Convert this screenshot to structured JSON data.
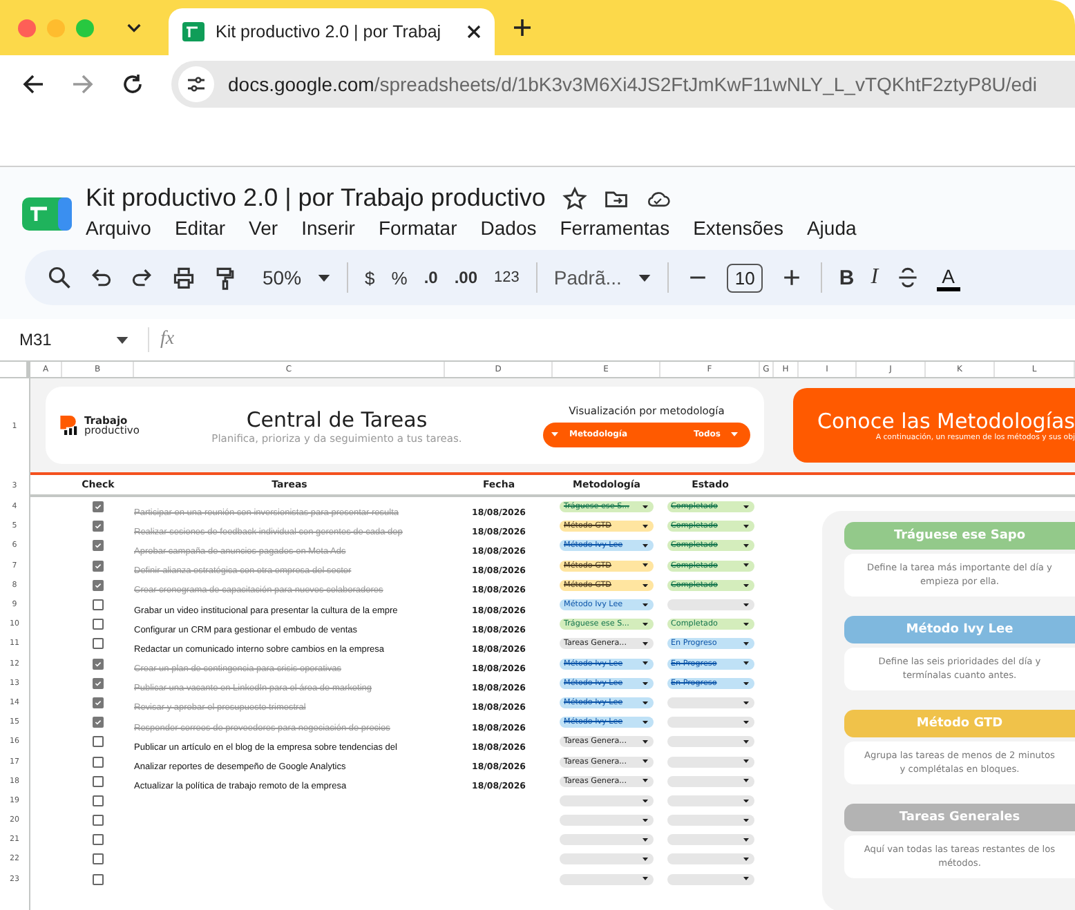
{
  "browser": {
    "tab_title": "Kit productivo 2.0 | por Trabaj",
    "url_domain": "docs.google.com",
    "url_path": "/spreadsheets/d/1bK3v3M6Xi4JS2FtJmKwF11wNLY_L_vTQKhtF2ztyP8U/edi"
  },
  "document": {
    "title": "Kit productivo 2.0 | por Trabajo productivo",
    "menus": [
      "Arquivo",
      "Editar",
      "Ver",
      "Inserir",
      "Formatar",
      "Dados",
      "Ferramentas",
      "Extensões",
      "Ajuda"
    ]
  },
  "toolbar": {
    "zoom": "50%",
    "currency": "$",
    "percent": "%",
    "decrease_decimals": ".0",
    "increase_decimals": ".00",
    "number_format": "123",
    "font": "Padrã...",
    "font_size": "10",
    "bold": "B",
    "italic": "I",
    "text_color": "A"
  },
  "formula_bar": {
    "cell": "M31",
    "fx": "fx"
  },
  "columns": [
    "A",
    "B",
    "C",
    "D",
    "E",
    "F",
    "G",
    "H",
    "I",
    "J",
    "K",
    "L"
  ],
  "row_numbers": [
    "1",
    "3",
    "4",
    "5",
    "6",
    "7",
    "8",
    "9",
    "10",
    "11",
    "12",
    "13",
    "14",
    "15",
    "16",
    "17",
    "18",
    "19",
    "20",
    "21",
    "22",
    "23"
  ],
  "header_card": {
    "logo_top": "Trabajo",
    "logo_bottom": "productivo",
    "title": "Central de Tareas",
    "subtitle": "Planifica, prioriza y da seguimiento a tus tareas.",
    "filter_label": "Visualización por metodología",
    "filter_method": "Metodología",
    "filter_status": "Todos"
  },
  "banner": {
    "title": "Conoce las Metodologías",
    "subtitle": "A continuación, un resumen de los métodos y sus obj"
  },
  "table_headers": [
    "Check",
    "Tareas",
    "Fecha",
    "Metodología",
    "Estado"
  ],
  "tasks": [
    {
      "checked": true,
      "task": "Participar en una reunión con inversionistas para presentar resulta",
      "date": "18/08/2026",
      "method": {
        "label": "Tráguese ese S...",
        "kind": "frog"
      },
      "status": {
        "label": "Completado",
        "kind": "done"
      }
    },
    {
      "checked": true,
      "task": "Realizar sesiones de feedback individual con gerentes de cada dep",
      "date": "18/08/2026",
      "method": {
        "label": "Método GTD",
        "kind": "gtd"
      },
      "status": {
        "label": "Completado",
        "kind": "done"
      }
    },
    {
      "checked": true,
      "task": "Aprobar campaña de anuncios pagados en Meta Ads",
      "date": "18/08/2026",
      "method": {
        "label": "Método Ivy Lee",
        "kind": "ivy"
      },
      "status": {
        "label": "Completado",
        "kind": "done"
      }
    },
    {
      "checked": true,
      "task": "Definir alianza estratégica con otra empresa del sector",
      "date": "18/08/2026",
      "method": {
        "label": "Método GTD",
        "kind": "gtd"
      },
      "status": {
        "label": "Completado",
        "kind": "done"
      }
    },
    {
      "checked": true,
      "task": "Crear cronograma de capacitación para nuevos colaboradores",
      "date": "18/08/2026",
      "method": {
        "label": "Método GTD",
        "kind": "gtd"
      },
      "status": {
        "label": "Completado",
        "kind": "done"
      }
    },
    {
      "checked": false,
      "task": "Grabar un video institucional para presentar la cultura de la empre",
      "date": "18/08/2026",
      "method": {
        "label": "Método Ivy Lee",
        "kind": "ivy"
      },
      "status": {
        "kind": "none"
      }
    },
    {
      "checked": false,
      "task": "Configurar un CRM para gestionar el embudo de ventas",
      "date": "18/08/2026",
      "method": {
        "label": "Tráguese ese S...",
        "kind": "frog"
      },
      "status": {
        "label": "Completado",
        "kind": "done"
      }
    },
    {
      "checked": false,
      "task": "Redactar un comunicado interno sobre cambios en la empresa",
      "date": "18/08/2026",
      "method": {
        "label": "Tareas Genera...",
        "kind": "general"
      },
      "status": {
        "label": "En Progreso",
        "kind": "progress"
      }
    },
    {
      "checked": true,
      "task": "Crear un plan de contingencia para crisis operativas",
      "date": "18/08/2026",
      "method": {
        "label": "Método Ivy Lee",
        "kind": "ivy"
      },
      "status": {
        "label": "En Progreso",
        "kind": "progress"
      }
    },
    {
      "checked": true,
      "task": "Publicar una vacante en LinkedIn para el área de marketing",
      "date": "18/08/2026",
      "method": {
        "label": "Método Ivy Lee",
        "kind": "ivy"
      },
      "status": {
        "label": "En Progreso",
        "kind": "progress"
      }
    },
    {
      "checked": true,
      "task": "Revisar y aprobar el presupuesto trimestral",
      "date": "18/08/2026",
      "method": {
        "label": "Método Ivy Lee",
        "kind": "ivy"
      },
      "status": {
        "kind": "none"
      }
    },
    {
      "checked": true,
      "task": "Responder correos de proveedores para negociación de precios",
      "date": "18/08/2026",
      "method": {
        "label": "Método Ivy Lee",
        "kind": "ivy"
      },
      "status": {
        "kind": "none"
      }
    },
    {
      "checked": false,
      "task": "Publicar un artículo en el blog de la empresa sobre tendencias del",
      "date": "18/08/2026",
      "method": {
        "label": "Tareas Genera...",
        "kind": "general"
      },
      "status": {
        "kind": "none"
      }
    },
    {
      "checked": false,
      "task": "Analizar reportes de desempeño de Google Analytics",
      "date": "18/08/2026",
      "method": {
        "label": "Tareas Genera...",
        "kind": "general"
      },
      "status": {
        "kind": "none"
      }
    },
    {
      "checked": false,
      "task": "Actualizar la política de trabajo remoto de la empresa",
      "date": "18/08/2026",
      "method": {
        "label": "Tareas Genera...",
        "kind": "general"
      },
      "status": {
        "kind": "none"
      }
    },
    {
      "checked": false,
      "method": {
        "kind": "none"
      },
      "status": {
        "kind": "none"
      }
    },
    {
      "checked": false,
      "method": {
        "kind": "none"
      },
      "status": {
        "kind": "none"
      }
    },
    {
      "checked": false,
      "method": {
        "kind": "none"
      },
      "status": {
        "kind": "none"
      }
    },
    {
      "checked": false,
      "method": {
        "kind": "none"
      },
      "status": {
        "kind": "none"
      }
    },
    {
      "checked": false,
      "method": {
        "kind": "none"
      },
      "status": {
        "kind": "none"
      }
    }
  ],
  "methods": [
    {
      "title": "Tráguese ese Sapo",
      "kind": "frog",
      "description": "Define la tarea más importante del día y empieza por ella."
    },
    {
      "title": "Método Ivy Lee",
      "kind": "ivy",
      "description": "Define las seis prioridades del día y termínalas cuanto antes."
    },
    {
      "title": "Método GTD",
      "kind": "gtd",
      "description": "Agrupa las tareas de menos de 2 minutos y complétalas en bloques."
    },
    {
      "title": "Tareas Generales",
      "kind": "general",
      "description": "Aquí van todas las tareas restantes de los métodos."
    }
  ]
}
